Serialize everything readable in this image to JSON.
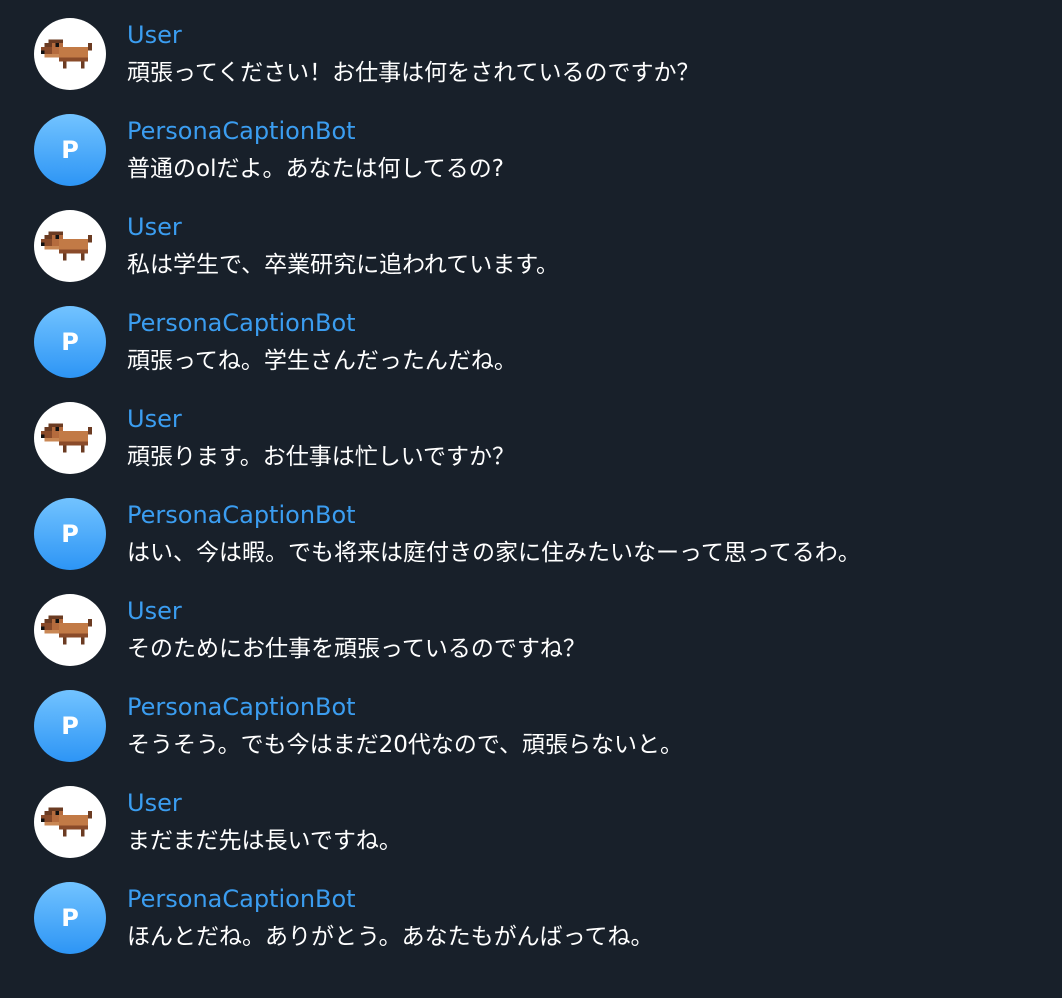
{
  "messages": [
    {
      "sender": "User",
      "text": "頑張ってください！お仕事は何をされているのですか？",
      "avatar": "dog-avatar-icon"
    },
    {
      "sender": "PersonaCaptionBot",
      "text": "普通のolだよ。あなたは何してるの?",
      "avatar_letter": "P"
    },
    {
      "sender": "User",
      "text": "私は学生で、卒業研究に追われています。",
      "avatar": "dog-avatar-icon"
    },
    {
      "sender": "PersonaCaptionBot",
      "text": "頑張ってね。学生さんだったんだね。",
      "avatar_letter": "P"
    },
    {
      "sender": "User",
      "text": "頑張ります。お仕事は忙しいですか？",
      "avatar": "dog-avatar-icon"
    },
    {
      "sender": "PersonaCaptionBot",
      "text": "はい、今は暇。でも将来は庭付きの家に住みたいなーって思ってるわ。",
      "avatar_letter": "P"
    },
    {
      "sender": "User",
      "text": "そのためにお仕事を頑張っているのですね？",
      "avatar": "dog-avatar-icon"
    },
    {
      "sender": "PersonaCaptionBot",
      "text": "そうそう。でも今はまだ20代なので、頑張らないと。",
      "avatar_letter": "P"
    },
    {
      "sender": "User",
      "text": "まだまだ先は長いですね。",
      "avatar": "dog-avatar-icon"
    },
    {
      "sender": "PersonaCaptionBot",
      "text": "ほんとだね。ありがとう。あなたもがんばってね。",
      "avatar_letter": "P"
    }
  ],
  "colors": {
    "background": "#18202a",
    "sender_name": "#3b9df0",
    "message_text": "#ffffff",
    "bot_avatar_gradient": [
      "#72c3ff",
      "#2d95f5"
    ]
  }
}
